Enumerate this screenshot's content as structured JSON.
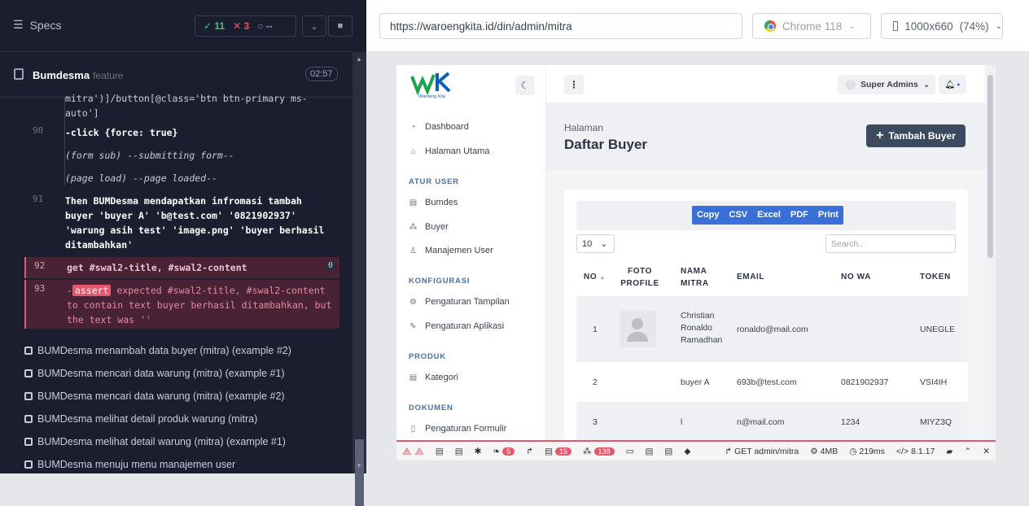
{
  "runner": {
    "title": "Specs",
    "passed": "11",
    "failed": "3",
    "pending": "--",
    "feature_name": "Bumdesma",
    "feature_tag": "feature",
    "duration": "02:57"
  },
  "commands": [
    {
      "ln": "",
      "text": "mitra')]/button[@class='btn btn-primary ms-auto']"
    },
    {
      "ln": "90",
      "text": "-click  {force: true}"
    },
    {
      "ln": "",
      "text": "(form sub)  --submitting form--"
    },
    {
      "ln": "",
      "text": "(page load)  --page loaded--"
    },
    {
      "ln": "91",
      "text": "Then  BUMDesma mendapatkan infromasi tambah buyer 'buyer A' 'b@test.com' '0821902937' 'warung asih test' 'image.png' 'buyer berhasil ditambahkan'"
    },
    {
      "ln": "92",
      "text": "get  #swal2-title, #swal2-content",
      "count": "0"
    },
    {
      "ln": "93",
      "assert": "assert",
      "pre": "-",
      "text": " expected #swal2-title, #swal2-content to contain text buyer berhasil ditambahkan, but the text was ''"
    }
  ],
  "tests": [
    "BUMDesma menambah data buyer (mitra) (example #2)",
    "BUMDesma mencari data warung (mitra) (example #1)",
    "BUMDesma mencari data warung (mitra) (example #2)",
    "BUMDesma melihat detail produk warung (mitra)",
    "BUMDesma melihat detail warung (mitra) (example #1)",
    "BUMDesma menuju menu manajemen user"
  ],
  "browser_bar": {
    "url": "https://waroengkita.id/din/admin/mitra",
    "browser": "Chrome 118",
    "viewport": "1000x660",
    "zoom": "(74%)"
  },
  "app": {
    "logo_text": "Waroeng Kita",
    "sidebar": {
      "items_top": [
        "Dashboard",
        "Halaman Utama"
      ],
      "sec_user": "ATUR USER",
      "items_user": [
        "Bumdes",
        "Buyer",
        "Manajemen User"
      ],
      "sec_config": "KONFIGURASI",
      "items_config": [
        "Pengaturan Tampilan",
        "Pengaturan Aplikasi"
      ],
      "sec_produk": "PRODUK",
      "items_produk": [
        "Kategori"
      ],
      "sec_dokumen": "DOKUMEN",
      "items_dokumen": [
        "Pengaturan Formulir"
      ]
    },
    "header": {
      "user": "Super Admins"
    },
    "page": {
      "crumb": "Halaman",
      "title": "Daftar Buyer",
      "add_label": "Tambah Buyer"
    },
    "table": {
      "exports": [
        "Copy",
        "CSV",
        "Excel",
        "PDF",
        "Print"
      ],
      "length": "10",
      "search_placeholder": "Search..",
      "headers": [
        "NO",
        "FOTO PROFILE",
        "NAMA MITRA",
        "EMAIL",
        "NO WA",
        "TOKEN"
      ],
      "rows": [
        {
          "no": "1",
          "nama": "Christian Ronaldo Ramadhan",
          "email": "ronaldo@mail.com",
          "wa": "",
          "token": "UNEGLE"
        },
        {
          "no": "2",
          "nama": "buyer A",
          "email": "693b@test.com",
          "wa": "0821902937",
          "token": "VSI4IH"
        },
        {
          "no": "3",
          "nama": "l",
          "email": "n@mail.com",
          "wa": "1234",
          "token": "MIYZ3Q"
        }
      ]
    },
    "debugbar": {
      "b1": "5",
      "b2": "15",
      "b3": "138",
      "route": "GET admin/mitra",
      "mem": "4MB",
      "time": "219ms",
      "ver": "8.1.17"
    }
  }
}
